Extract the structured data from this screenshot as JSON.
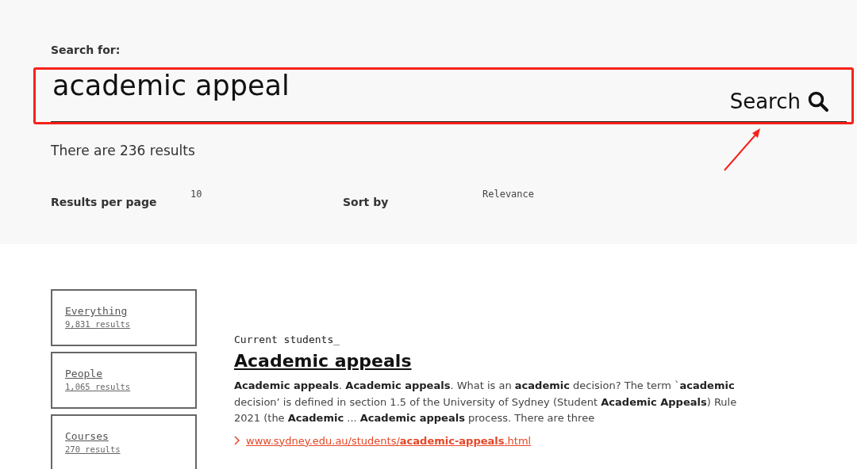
{
  "search": {
    "label": "Search for:",
    "value": "academic appeal",
    "button": "Search"
  },
  "summary": "There are 236 results",
  "options": [
    {
      "label": "Results per page",
      "value": "10"
    },
    {
      "label": "Sort by",
      "value": "Relevance"
    }
  ],
  "facets": [
    {
      "name": "Everything",
      "count": "9,831 results"
    },
    {
      "name": "People",
      "count": "1,065 results"
    },
    {
      "name": "Courses",
      "count": "270 results"
    }
  ],
  "results": [
    {
      "category": "Current students_",
      "title": "Academic appeals",
      "snippet": "**Academic appeals**. **Academic appeals**. What is an **academic** decision? The term `**academic** decision’ is defined in section 1.5 of the University of Sydney (Student **Academic Appeals**) Rule 2021 (the **Academic** ... **Academic appeals** process. There are three",
      "url": "www.sydney.edu.au/students/**academic-appeals**.html"
    }
  ],
  "annotation": {
    "kind": "highlight"
  }
}
